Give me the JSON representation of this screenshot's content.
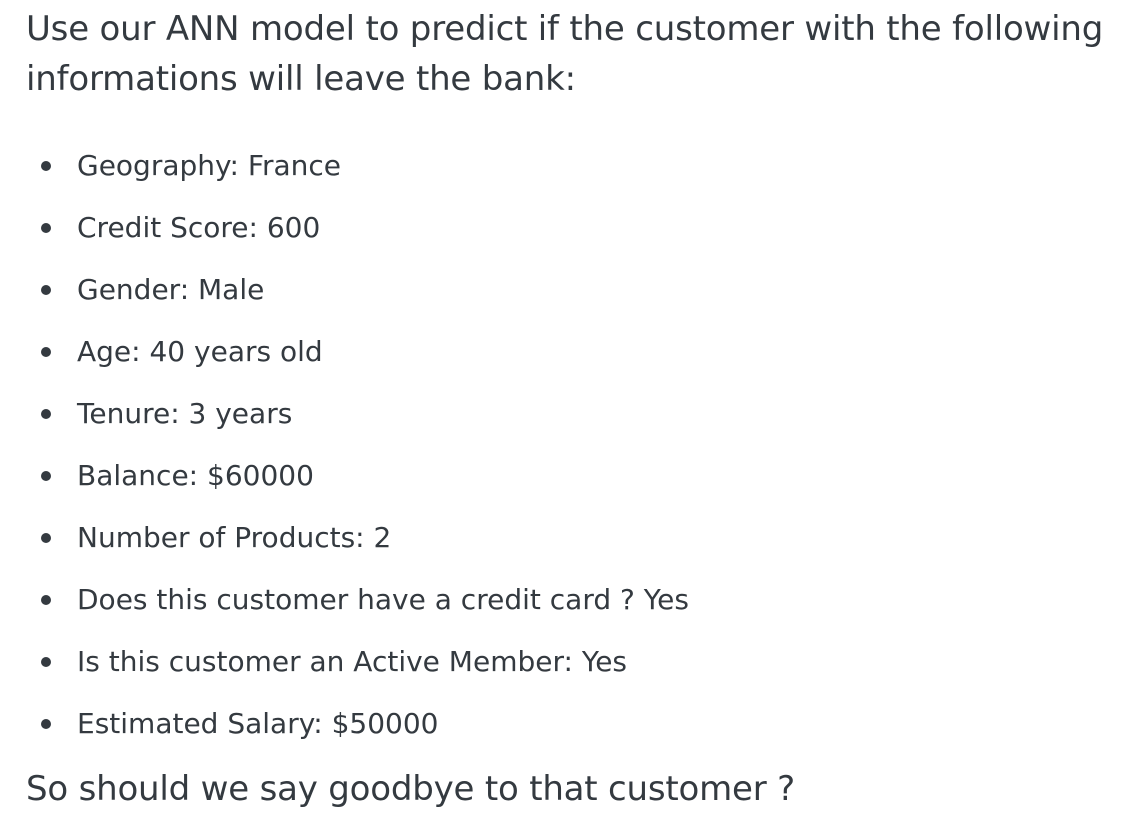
{
  "intro_text": "Use our ANN model to predict if the customer with the following informations will leave the bank:",
  "customer_details": [
    "Geography: France",
    "Credit Score: 600",
    "Gender: Male",
    "Age: 40 years old",
    "Tenure: 3 years",
    "Balance: $60000",
    "Number of Products: 2",
    "Does this customer have a credit card ? Yes",
    "Is this customer an Active Member: Yes",
    "Estimated Salary: $50000"
  ],
  "closing_question": "So should we say goodbye to that customer ?"
}
